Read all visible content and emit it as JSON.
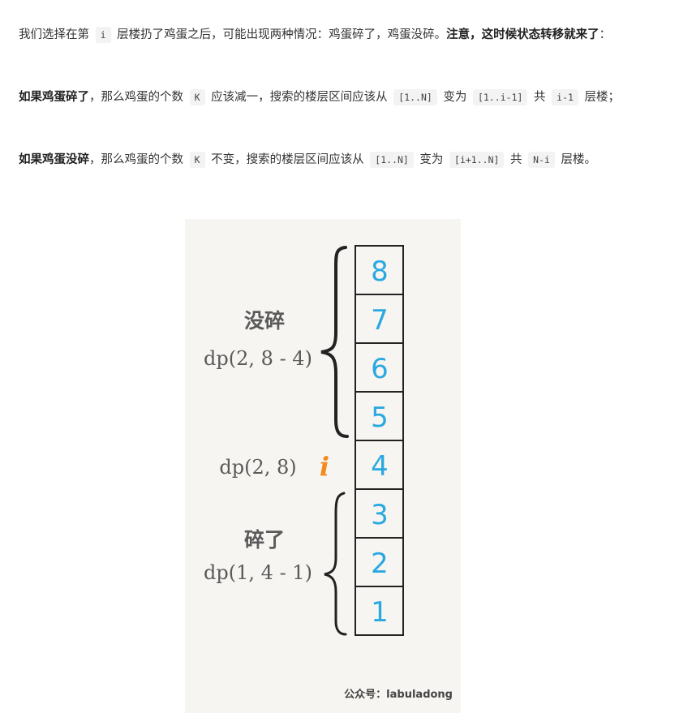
{
  "paragraphs": [
    {
      "segments": [
        {
          "t": "text",
          "v": "我们选择在第 "
        },
        {
          "t": "code",
          "v": "i"
        },
        {
          "t": "text",
          "v": " 层楼扔了鸡蛋之后，可能出现两种情况：鸡蛋碎了，鸡蛋没碎。"
        },
        {
          "t": "bold",
          "v": "注意，这时候状态转移就来了"
        },
        {
          "t": "text",
          "v": "："
        }
      ]
    },
    {
      "segments": [
        {
          "t": "bold",
          "v": "如果鸡蛋碎了"
        },
        {
          "t": "text",
          "v": "，那么鸡蛋的个数 "
        },
        {
          "t": "code",
          "v": "K"
        },
        {
          "t": "text",
          "v": " 应该减一，搜索的楼层区间应该从 "
        },
        {
          "t": "code",
          "v": "[1..N]"
        },
        {
          "t": "text",
          "v": " 变为 "
        },
        {
          "t": "code",
          "v": "[1..i-1]"
        },
        {
          "t": "text",
          "v": " 共 "
        },
        {
          "t": "code",
          "v": "i-1"
        },
        {
          "t": "text",
          "v": " 层楼；"
        }
      ]
    },
    {
      "segments": [
        {
          "t": "bold",
          "v": "如果鸡蛋没碎"
        },
        {
          "t": "text",
          "v": "，那么鸡蛋的个数 "
        },
        {
          "t": "code",
          "v": "K"
        },
        {
          "t": "text",
          "v": " 不变，搜索的楼层区间应该从 "
        },
        {
          "t": "code",
          "v": "[1..N]"
        },
        {
          "t": "text",
          "v": " 变为 "
        },
        {
          "t": "code",
          "v": "[i+1..N]"
        },
        {
          "t": "text",
          "v": " 共 "
        },
        {
          "t": "code",
          "v": "N-i"
        },
        {
          "t": "text",
          "v": " 层楼。"
        }
      ]
    }
  ],
  "figure": {
    "floors": [
      "8",
      "7",
      "6",
      "5",
      "4",
      "3",
      "2",
      "1"
    ],
    "upper_label": "没碎",
    "upper_formula": "dp(2, 8 - 4)",
    "middle_formula": "dp(2, 8)",
    "middle_marker": "i",
    "lower_label": "碎了",
    "lower_formula": "dp(1, 4 - 1)",
    "credit": "公众号：labuladong",
    "colors": {
      "background": "#f7f5f2",
      "ink": "#222222",
      "floor_number": "#2aa8e0",
      "marker": "#f28a1e",
      "label": "#5a5a5a"
    }
  }
}
